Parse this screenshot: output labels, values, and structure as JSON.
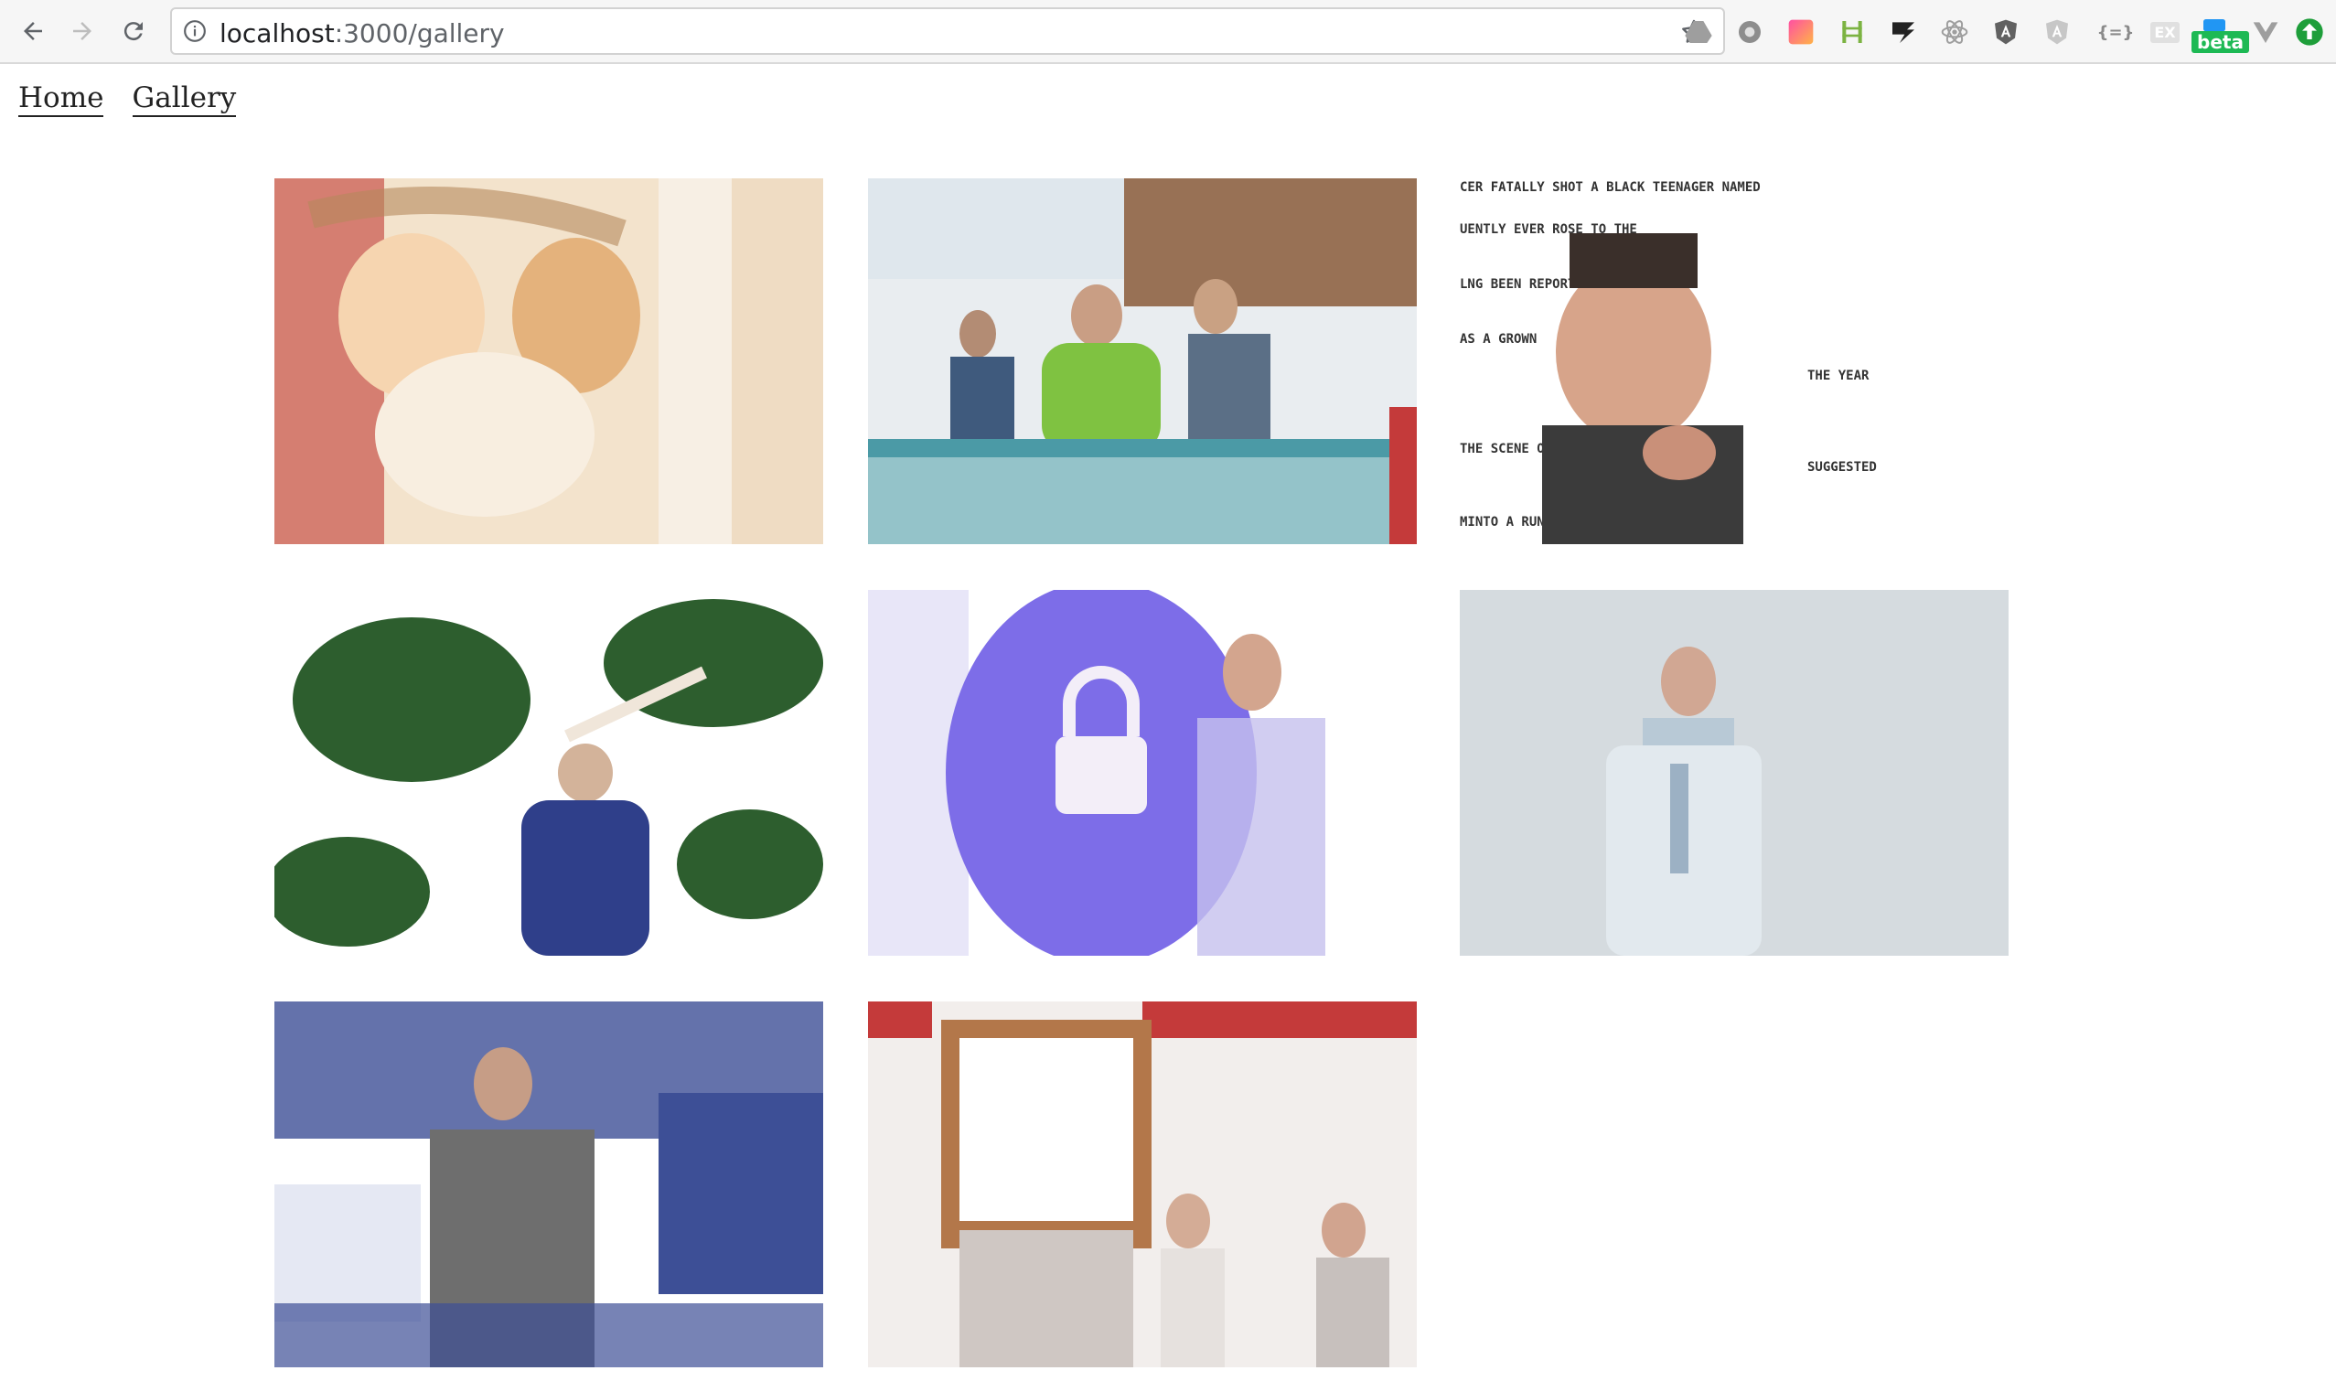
{
  "browser": {
    "url_host": "localhost",
    "url_path": ":3000/gallery",
    "beta_badge": "beta",
    "ext_json_label": "{=}",
    "ext_ex_label": "EX"
  },
  "nav": {
    "home": "Home",
    "gallery": "Gallery"
  },
  "gallery": {
    "items": [
      {
        "icon": "mosaic-painting-image",
        "accent": "#b5895c"
      },
      {
        "icon": "mosaic-meeting-image",
        "accent": "#7fc241"
      },
      {
        "icon": "mosaic-portrait-image",
        "accent": "#333333"
      },
      {
        "icon": "mosaic-golfer-image",
        "accent": "#2d5e2e"
      },
      {
        "icon": "mosaic-lock-image",
        "accent": "#7d6de8"
      },
      {
        "icon": "mosaic-man-standing-image",
        "accent": "#b8c9d6"
      },
      {
        "icon": "mosaic-seated-man-image",
        "accent": "#3d4f96"
      },
      {
        "icon": "mosaic-podium-image",
        "accent": "#c43a3a"
      }
    ]
  }
}
